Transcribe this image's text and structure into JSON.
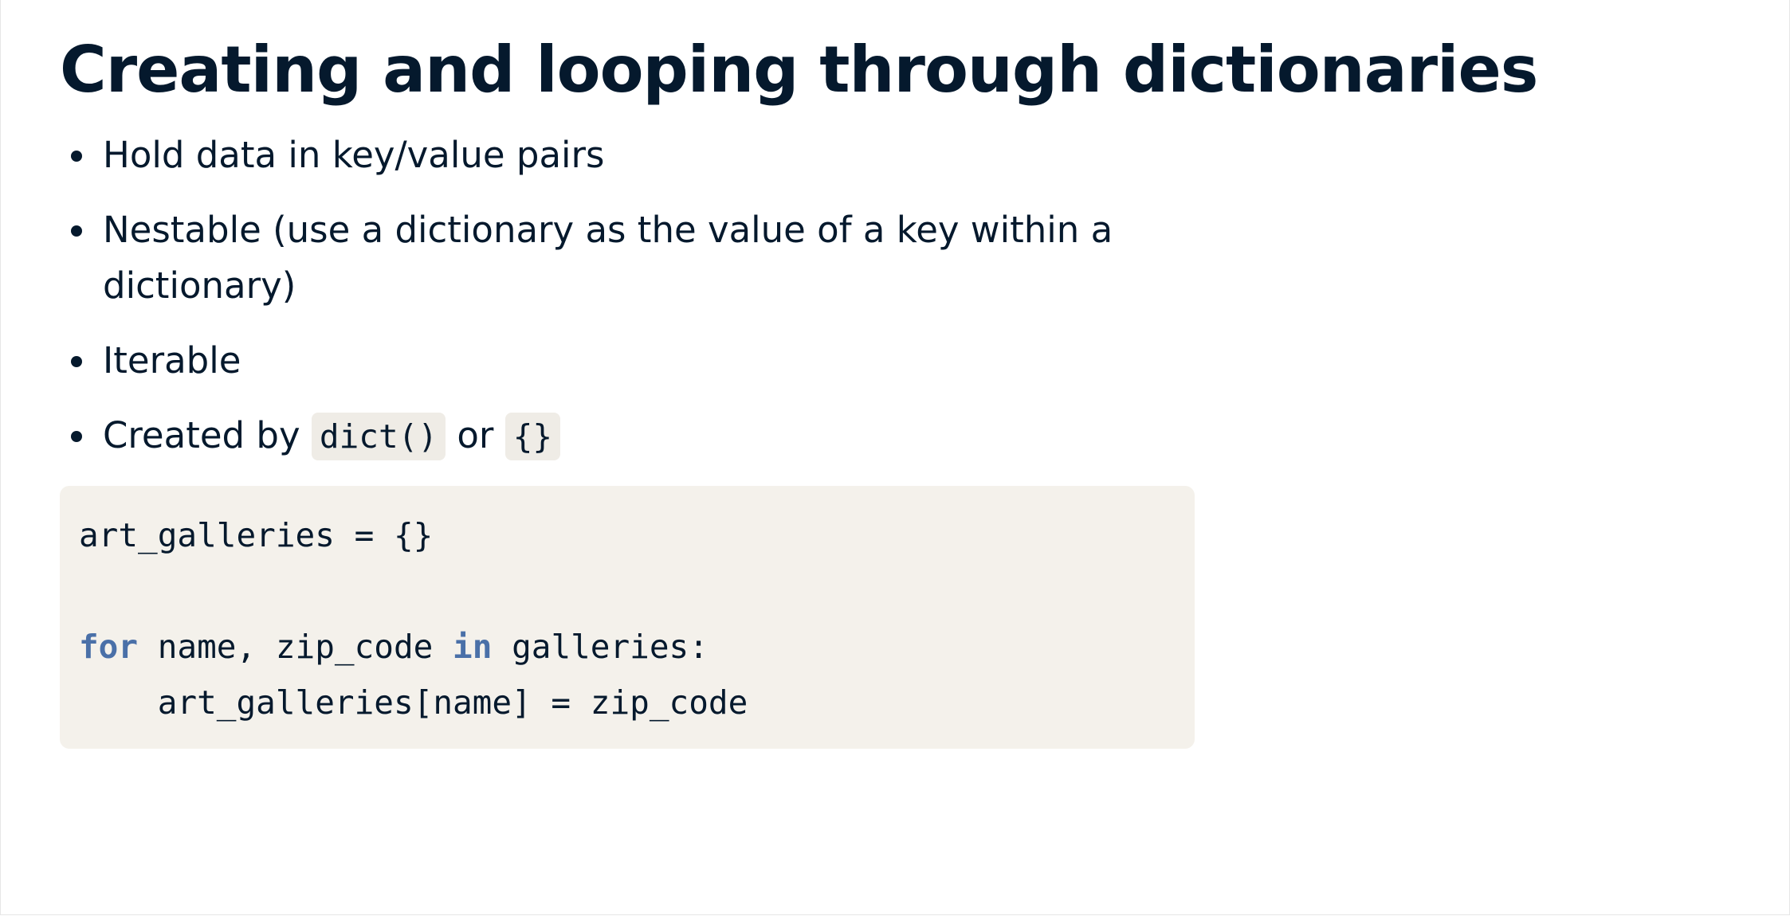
{
  "slide": {
    "title": "Creating and looping through dictionaries",
    "bullets": [
      {
        "text": "Hold data in key/value pairs"
      },
      {
        "text": "Nestable (use a dictionary as the value of a key within a dictionary)"
      },
      {
        "text": "Iterable"
      },
      {
        "prefix": "Created by",
        "code1": "dict()",
        "middle": "or",
        "code2": "{}"
      }
    ],
    "code": {
      "line1": "art_galleries = {}",
      "line3_kw1": "for",
      "line3_mid": " name, zip_code ",
      "line3_kw2": "in",
      "line3_end": " galleries:",
      "line4": "    art_galleries[name] = zip_code"
    }
  },
  "colors": {
    "text": "#05192d",
    "keyword": "#4a70a8",
    "code_background": "#f4f1eb"
  }
}
